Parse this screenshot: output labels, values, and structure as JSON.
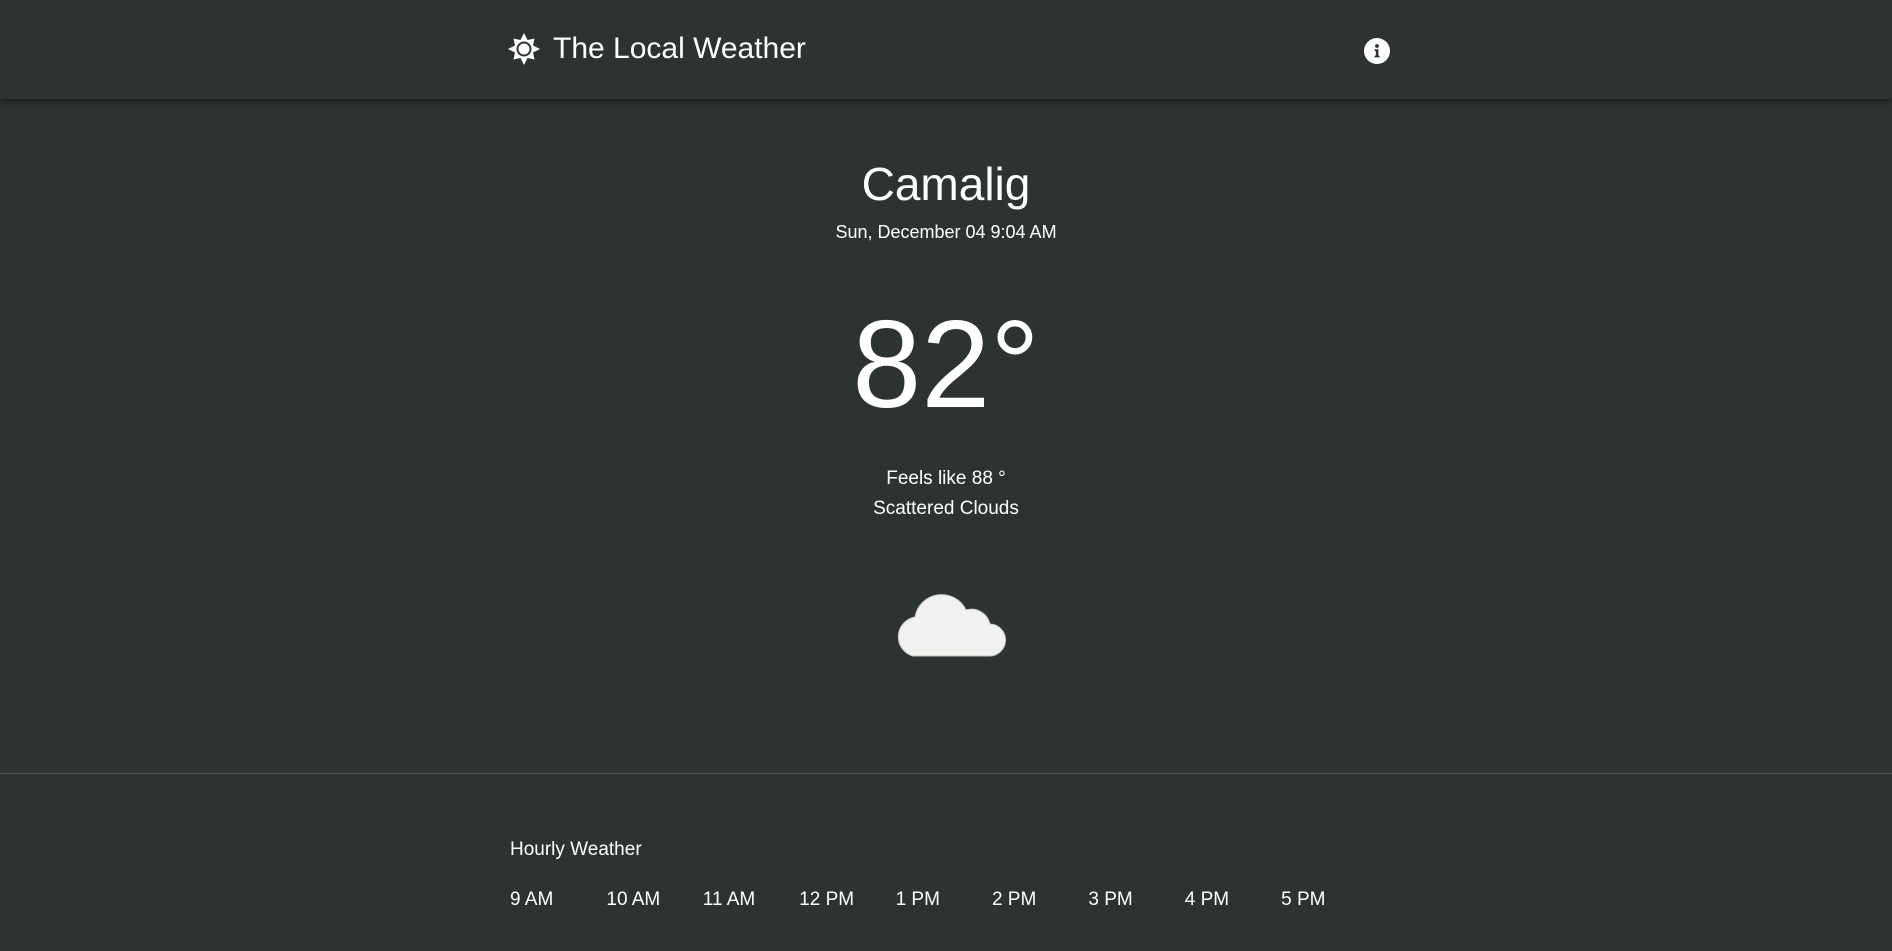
{
  "header": {
    "title": "The Local Weather",
    "logo_icon": "sun-icon",
    "info_icon": "info-icon"
  },
  "current": {
    "city": "Camalig",
    "datetime": "Sun, December 04 9:04 AM",
    "temperature": "82°",
    "feels_like": "Feels like 88 °",
    "condition": "Scattered Clouds",
    "condition_icon": "cloud-icon"
  },
  "hourly": {
    "title": "Hourly Weather",
    "hours": [
      "9 AM",
      "10 AM",
      "11 AM",
      "12 PM",
      "1 PM",
      "2 PM",
      "3 PM",
      "4 PM",
      "5 PM"
    ]
  },
  "colors": {
    "background": "#2d3333",
    "text": "#ffffff",
    "cloud": "#f1f1ef"
  }
}
